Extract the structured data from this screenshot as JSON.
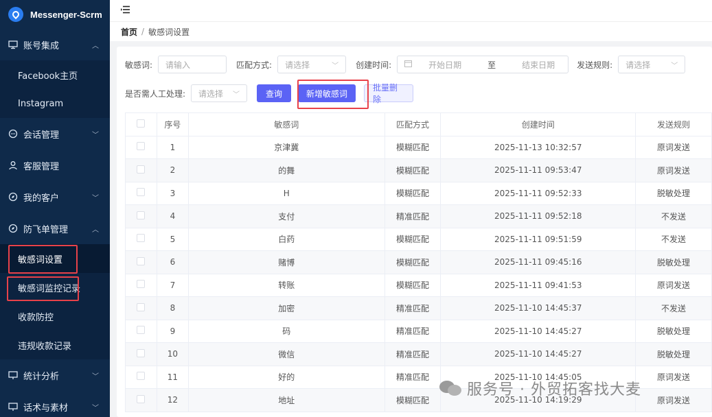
{
  "app": {
    "title": "Messenger-Scrm"
  },
  "sidebar": {
    "groups": [
      {
        "label": "账号集成",
        "icon": "presentation-icon",
        "expanded": true
      },
      {
        "label": "会话管理",
        "icon": "chat-icon",
        "expanded": false
      },
      {
        "label": "客服管理",
        "icon": "user-icon",
        "expanded": false
      },
      {
        "label": "我的客户",
        "icon": "compass-icon",
        "expanded": false
      },
      {
        "label": "防飞单管理",
        "icon": "compass-icon",
        "expanded": true
      },
      {
        "label": "统计分析",
        "icon": "monitor-icon",
        "expanded": false
      },
      {
        "label": "话术与素材",
        "icon": "monitor-icon",
        "expanded": false
      }
    ],
    "account_items": [
      "Facebook主页",
      "Instagram"
    ],
    "anti_items": [
      "敏感词设置",
      "敏感词监控记录",
      "收款防控",
      "违规收款记录"
    ]
  },
  "breadcrumb": {
    "home": "首页",
    "separator": "/",
    "current": "敏感词设置"
  },
  "filters": {
    "word_label": "敏感词:",
    "word_placeholder": "请输入",
    "match_label": "匹配方式:",
    "match_placeholder": "请选择",
    "created_label": "创建时间:",
    "start_placeholder": "开始日期",
    "range_sep": "至",
    "end_placeholder": "结束日期",
    "rule_label": "发送规则:",
    "rule_placeholder": "请选择",
    "manual_label": "是否需人工处理:",
    "manual_placeholder": "请选择"
  },
  "buttons": {
    "query": "查询",
    "add": "新增敏感词",
    "batch_delete": "批量删除"
  },
  "table": {
    "headers": [
      "序号",
      "敏感词",
      "匹配方式",
      "创建时间",
      "发送规则"
    ],
    "rows": [
      [
        "1",
        "京津冀",
        "模糊匹配",
        "2025-11-13 10:32:57",
        "原词发送"
      ],
      [
        "2",
        "的舞",
        "模糊匹配",
        "2025-11-11 09:53:47",
        "原词发送"
      ],
      [
        "3",
        "H",
        "模糊匹配",
        "2025-11-11 09:52:33",
        "脱敏处理"
      ],
      [
        "4",
        "支付",
        "精准匹配",
        "2025-11-11 09:52:18",
        "不发送"
      ],
      [
        "5",
        "白药",
        "模糊匹配",
        "2025-11-11 09:51:59",
        "不发送"
      ],
      [
        "6",
        "赌博",
        "模糊匹配",
        "2025-11-11 09:45:16",
        "脱敏处理"
      ],
      [
        "7",
        "转账",
        "模糊匹配",
        "2025-11-11 09:41:53",
        "原词发送"
      ],
      [
        "8",
        "加密",
        "精准匹配",
        "2025-11-10 14:45:37",
        "不发送"
      ],
      [
        "9",
        "码",
        "精准匹配",
        "2025-11-10 14:45:27",
        "脱敏处理"
      ],
      [
        "10",
        "微信",
        "精准匹配",
        "2025-11-10 14:45:27",
        "脱敏处理"
      ],
      [
        "11",
        "好的",
        "精准匹配",
        "2025-11-10 14:45:05",
        "原词发送"
      ],
      [
        "12",
        "地址",
        "模糊匹配",
        "2025-11-10 14:19:29",
        "原词发送"
      ]
    ]
  },
  "watermark": {
    "text": "服务号 · 外贸拓客找大麦"
  },
  "colors": {
    "sidebar": "#0f2a4a",
    "primary": "#5b63f5",
    "highlight": "#e8424a"
  }
}
